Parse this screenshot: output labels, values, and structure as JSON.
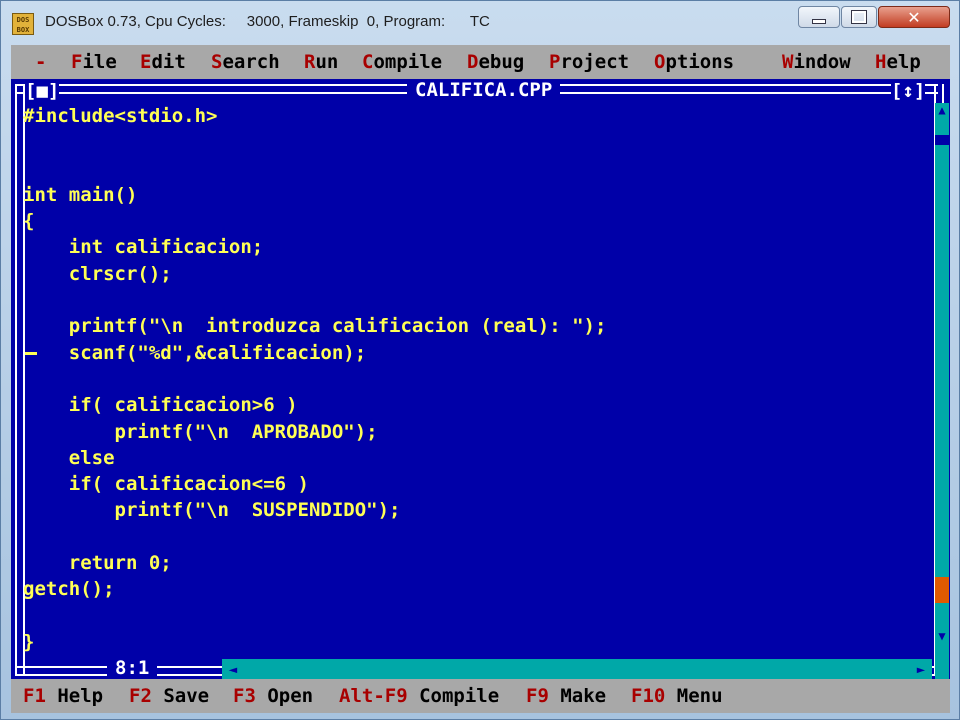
{
  "window": {
    "title": "DOSBox 0.73, Cpu Cycles:     3000, Frameskip  0, Program:      TC",
    "icon": "dosbox-icon"
  },
  "menu": {
    "system": "-",
    "items": [
      {
        "hot": "F",
        "rest": "ile"
      },
      {
        "hot": "E",
        "rest": "dit"
      },
      {
        "hot": "S",
        "rest": "earch"
      },
      {
        "hot": "R",
        "rest": "un"
      },
      {
        "hot": "C",
        "rest": "ompile"
      },
      {
        "hot": "D",
        "rest": "ebug"
      },
      {
        "hot": "P",
        "rest": "roject"
      },
      {
        "hot": "O",
        "rest": "ptions"
      },
      {
        "hot": "W",
        "rest": "indow"
      },
      {
        "hot": "H",
        "rest": "elp"
      }
    ]
  },
  "editor": {
    "filename": "CALIFICA.CPP",
    "close_box": "[■]",
    "zoom_box": "[↕]",
    "cursor_position": "8:1",
    "code_lines": [
      "#include<stdio.h>",
      "",
      "",
      "int main()",
      "{",
      "    int calificacion;",
      "    clrscr();",
      "",
      "    printf(\"\\n  introduzca calificacion (real): \");",
      "    scanf(\"%d\",&calificacion);",
      "",
      "    if( calificacion>6 )",
      "        printf(\"\\n  APROBADO\");",
      "    else",
      "    if( calificacion<=6 )",
      "        printf(\"\\n  SUSPENDIDO\");",
      "",
      "    return 0;",
      "getch();",
      "",
      "}"
    ]
  },
  "statusbar": {
    "items": [
      {
        "key": "F1",
        "label": " Help"
      },
      {
        "key": "F2",
        "label": " Save"
      },
      {
        "key": "F3",
        "label": " Open"
      },
      {
        "key": "Alt-F9",
        "label": " Compile"
      },
      {
        "key": "F9",
        "label": " Make"
      },
      {
        "key": "F10",
        "label": " Menu"
      }
    ]
  },
  "colors": {
    "background": "#0000a8",
    "code_text": "#ffff54",
    "menu_bg": "#a8a8a8",
    "hotkey": "#a80000",
    "scrollbar": "#00a8a8"
  }
}
